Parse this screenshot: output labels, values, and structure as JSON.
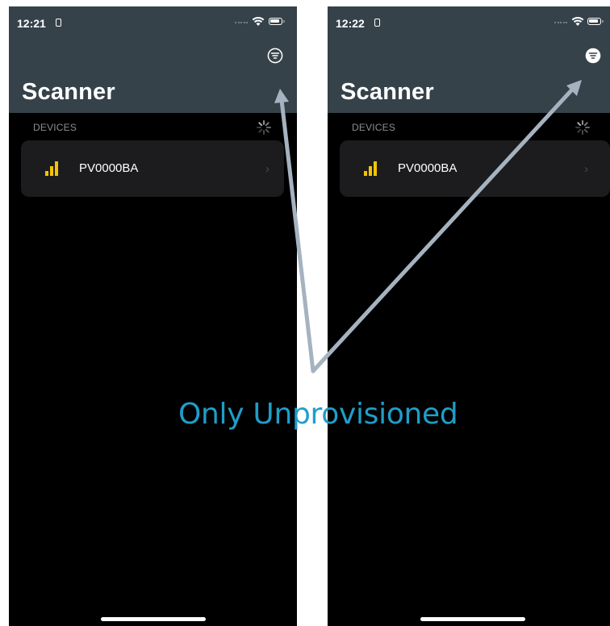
{
  "screens": [
    {
      "status_time": "12:21",
      "title": "Scanner",
      "filter_icon": "filter-outline-icon",
      "section_label": "DEVICES",
      "devices": [
        {
          "name": "PV0000BA",
          "icon": "signal-strength-icon"
        }
      ]
    },
    {
      "status_time": "12:22",
      "title": "Scanner",
      "filter_icon": "filter-filled-icon",
      "section_label": "DEVICES",
      "devices": [
        {
          "name": "PV0000BA",
          "icon": "signal-strength-icon"
        }
      ]
    }
  ],
  "annotation": {
    "text": "Only Unprovisioned"
  },
  "colors": {
    "nav_background": "#36424a",
    "screen_background": "#000000",
    "row_background": "#1c1c1e",
    "signal_bars": "#f5c400",
    "arrow": "#a5b3c0",
    "caption": "#1f9ec9"
  }
}
